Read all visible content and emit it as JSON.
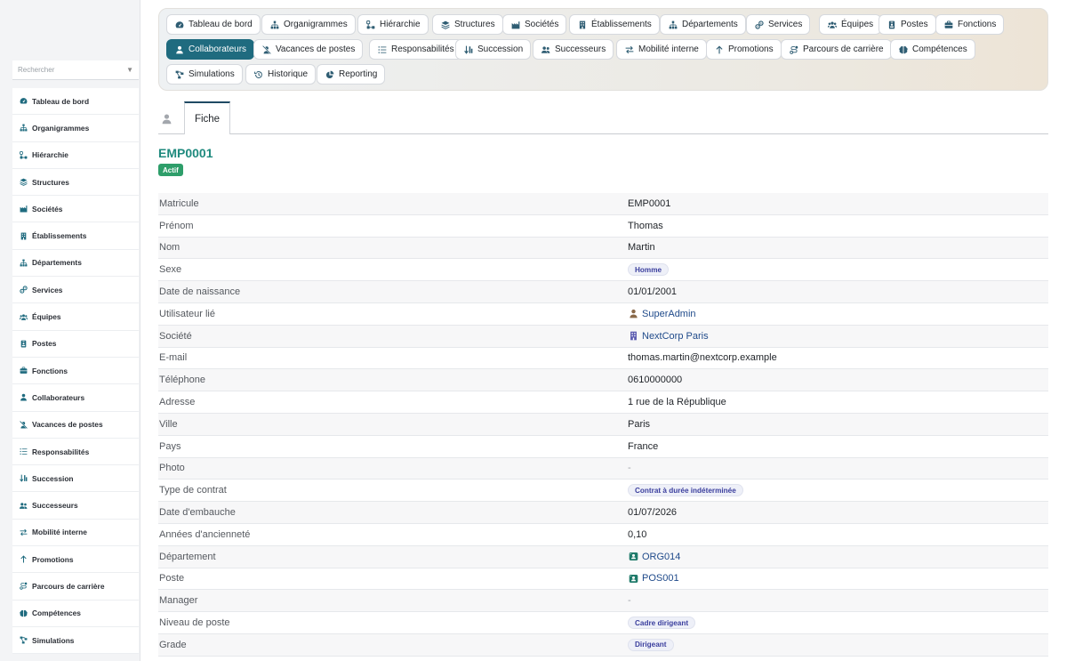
{
  "sidebar": {
    "search_placeholder": "Rechercher",
    "items": [
      {
        "label": "Tableau de bord",
        "icon": "gauge-icon"
      },
      {
        "label": "Organigrammes",
        "icon": "sitemap-icon"
      },
      {
        "label": "Hiérarchie",
        "icon": "hierarchy-icon"
      },
      {
        "label": "Structures",
        "icon": "layers-icon"
      },
      {
        "label": "Sociétés",
        "icon": "industry-icon"
      },
      {
        "label": "Établissements",
        "icon": "building-icon"
      },
      {
        "label": "Départements",
        "icon": "sitemap-icon"
      },
      {
        "label": "Services",
        "icon": "services-icon"
      },
      {
        "label": "Équipes",
        "icon": "users-icon"
      },
      {
        "label": "Postes",
        "icon": "badge-icon"
      },
      {
        "label": "Fonctions",
        "icon": "briefcase-icon"
      },
      {
        "label": "Collaborateurs",
        "icon": "user-icon"
      },
      {
        "label": "Vacances de postes",
        "icon": "user-slash-icon"
      },
      {
        "label": "Responsabilités",
        "icon": "list-icon"
      },
      {
        "label": "Succession",
        "icon": "sort-icon"
      },
      {
        "label": "Successeurs",
        "icon": "user-friends-icon"
      },
      {
        "label": "Mobilité interne",
        "icon": "exchange-icon"
      },
      {
        "label": "Promotions",
        "icon": "arrow-up-icon"
      },
      {
        "label": "Parcours de carrière",
        "icon": "route-icon"
      },
      {
        "label": "Compétences",
        "icon": "brain-icon"
      },
      {
        "label": "Simulations",
        "icon": "project-diagram-icon"
      }
    ]
  },
  "topnav": {
    "items": [
      {
        "label": "Tableau de bord",
        "icon": "gauge-icon"
      },
      {
        "label": "Organigrammes",
        "icon": "sitemap-icon"
      },
      {
        "label": "Hiérarchie",
        "icon": "hierarchy-icon"
      },
      {
        "label": "Structures",
        "icon": "layers-icon"
      },
      {
        "label": "Sociétés",
        "icon": "industry-icon"
      },
      {
        "label": "Établissements",
        "icon": "building-icon"
      },
      {
        "label": "Départements",
        "icon": "sitemap-icon"
      },
      {
        "label": "Services",
        "icon": "services-icon"
      },
      {
        "label": "Équipes",
        "icon": "users-icon"
      },
      {
        "label": "Postes",
        "icon": "badge-icon"
      },
      {
        "label": "Fonctions",
        "icon": "briefcase-icon"
      },
      {
        "label": "Collaborateurs",
        "icon": "user-icon",
        "active": true
      },
      {
        "label": "Vacances de postes",
        "icon": "user-slash-icon"
      },
      {
        "label": "Responsabilités",
        "icon": "list-icon"
      },
      {
        "label": "Succession",
        "icon": "sort-icon"
      },
      {
        "label": "Successeurs",
        "icon": "user-friends-icon"
      },
      {
        "label": "Mobilité interne",
        "icon": "exchange-icon"
      },
      {
        "label": "Promotions",
        "icon": "arrow-up-icon"
      },
      {
        "label": "Parcours de carrière",
        "icon": "route-icon"
      },
      {
        "label": "Compétences",
        "icon": "brain-icon"
      },
      {
        "label": "Simulations",
        "icon": "project-diagram-icon"
      },
      {
        "label": "Historique",
        "icon": "history-icon"
      },
      {
        "label": "Reporting",
        "icon": "pie-chart-icon"
      }
    ]
  },
  "tabs": {
    "user_icon": "user-icon",
    "fiche_label": "Fiche"
  },
  "record": {
    "title": "EMP0001",
    "status": "Actif",
    "fields": [
      {
        "label": "Matricule",
        "value": "EMP0001",
        "kind": "text"
      },
      {
        "label": "Prénom",
        "value": "Thomas",
        "kind": "text"
      },
      {
        "label": "Nom",
        "value": "Martin",
        "kind": "text"
      },
      {
        "label": "Sexe",
        "value": "Homme",
        "kind": "badge"
      },
      {
        "label": "Date de naissance",
        "value": "01/01/2001",
        "kind": "text"
      },
      {
        "label": "Utilisateur lié",
        "value": "SuperAdmin",
        "kind": "link",
        "icon": "user-icon",
        "icon_color": "#8a6a4a"
      },
      {
        "label": "Société",
        "value": "NextCorp Paris",
        "kind": "link",
        "icon": "building-icon",
        "icon_color": "#5a5ab0"
      },
      {
        "label": "E-mail",
        "value": "thomas.martin@nextcorp.example",
        "kind": "text"
      },
      {
        "label": "Téléphone",
        "value": "0610000000",
        "kind": "text"
      },
      {
        "label": "Adresse",
        "value": "1 rue de la République",
        "kind": "text"
      },
      {
        "label": "Ville",
        "value": "Paris",
        "kind": "text"
      },
      {
        "label": "Pays",
        "value": "France",
        "kind": "text"
      },
      {
        "label": "Photo",
        "value": "-",
        "kind": "muted"
      },
      {
        "label": "Type de contrat",
        "value": "Contrat à durée indéterminée",
        "kind": "badge"
      },
      {
        "label": "Date d'embauche",
        "value": "01/07/2026",
        "kind": "text"
      },
      {
        "label": "Années d'ancienneté",
        "value": "0,10",
        "kind": "text"
      },
      {
        "label": "Département",
        "value": "ORG014",
        "kind": "link",
        "icon": "org-icon",
        "icon_color": "#1f7a6a"
      },
      {
        "label": "Poste",
        "value": "POS001",
        "kind": "link",
        "icon": "org-icon",
        "icon_color": "#1f7a6a"
      },
      {
        "label": "Manager",
        "value": "-",
        "kind": "muted"
      },
      {
        "label": "Niveau de poste",
        "value": "Cadre dirigeant",
        "kind": "badge"
      },
      {
        "label": "Grade",
        "value": "Dirigeant",
        "kind": "badge"
      }
    ]
  },
  "colors": {
    "accent": "#1f6b7f",
    "title": "#1f8a7e",
    "status": "#2e9e6a",
    "link": "#1f4a8a"
  }
}
